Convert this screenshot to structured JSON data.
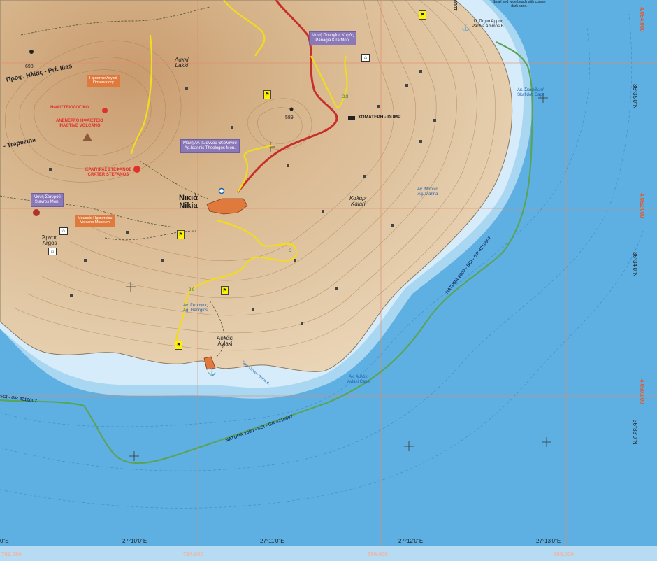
{
  "places": {
    "nikia": {
      "greek": "Νικιά",
      "latin": "Nikia"
    },
    "avlaki": {
      "greek": "Αυλάκι",
      "latin": "Avlaki"
    },
    "argos": {
      "greek": "Άργος",
      "latin": "Argos"
    },
    "lakki": {
      "greek": "Λακκί",
      "latin": "Lakki"
    },
    "kalari": {
      "greek": "Καλάρι",
      "latin": "Kalari"
    },
    "trapezina": "- Trapezina",
    "prof_ilias": "Προφ. Ηλίας - Prf. Ilias"
  },
  "peaks": {
    "p698": "698",
    "p589": "589"
  },
  "purple_labels": {
    "panagia_kira": [
      "Μονή Παναγίας Κυράς",
      "Panagia Kira Mon."
    ],
    "theologos": [
      "Μονή Αγ. Ιωάννου Θεολόγου",
      "Ag.Ioannis Theologos Mon."
    ],
    "stavros": [
      "Μονή Σταυρού",
      "Stavros Mon."
    ]
  },
  "orange_labels": {
    "volcanological": [
      "Ηφαιστειολογικό",
      "Observatory"
    ],
    "museum": [
      "Μουσείο Ηφαιστείου",
      "Volcano Museum"
    ]
  },
  "red_labels": {
    "volcano_center": "ΗΦΑΙΣΤΕΙΟΛΟΓΙΚΟ",
    "active_volcano": [
      "ΑΝΕΝΕΡΓΟ ΗΦΑΙΣΤΕΙΟ",
      "INACTIVE VOLCANO"
    ],
    "crater_stefanos": [
      "ΚΡΑΤΗΡΑΣ ΣΤΕΦΑΝΟΣ",
      "CRATER STEFANOS"
    ]
  },
  "features": {
    "dump": "ΧΩΜΑΤΕΡΗ - DUMP",
    "pachia": [
      "Π. Παχιά Άμμος",
      "Pachia Ammos B."
    ],
    "beach_note": [
      "Small and wide beach with coarse",
      "dark sand."
    ],
    "skafidoti": [
      "Ακ. Σκαφιδωτή",
      "Skafidoti Cape"
    ],
    "ag_marina": [
      "Αγ. Μαρίνα",
      "Ag. Marina"
    ],
    "ag_georgios": [
      "Αγ. Γεώργιος",
      "Ag. Georgios"
    ],
    "avlaki_cape": [
      "Ακ. Αυλάκι",
      "Avlaki Cape"
    ],
    "oros_gerou": "Όρμ. Γέρου - Gerou B.",
    "route_0007": "0007",
    "route_28": "2.8",
    "route_29": "2.9",
    "route_3": "3"
  },
  "natura": {
    "label1": "NATURA 2000 - SCI - GR 4210007",
    "label2": "NATURA 2000 - SCI - GR 4210007",
    "label3": "SCI - GR 4210007"
  },
  "coords_lat": {
    "lat1": "36°35'0\"N",
    "lat2": "36°34'0\"N",
    "lat3": "36°33'0\"N"
  },
  "coords_north": {
    "n1": "4.054.000",
    "n2": "4.052.000",
    "n3": "4.050.000"
  },
  "coords_lon": {
    "lon0": "0\"E",
    "lon1": "27°10'0\"E",
    "lon2": "27°11'0\"E",
    "lon3": "27°12'0\"E",
    "lon4": "27°13'0\"E"
  },
  "coords_east": {
    "e1": "782.000",
    "e2": "784.000",
    "e3": "786.000",
    "e4": "788.000"
  },
  "colors": {
    "sea_deep": "#5fb0e2",
    "sea_shallow": "#a8d6f2",
    "land": "#dcc09a",
    "road_red": "#c7302a",
    "road_yellow": "#f1dc1e",
    "natura_line": "#5aa45a",
    "grid": "#e28a6a"
  }
}
